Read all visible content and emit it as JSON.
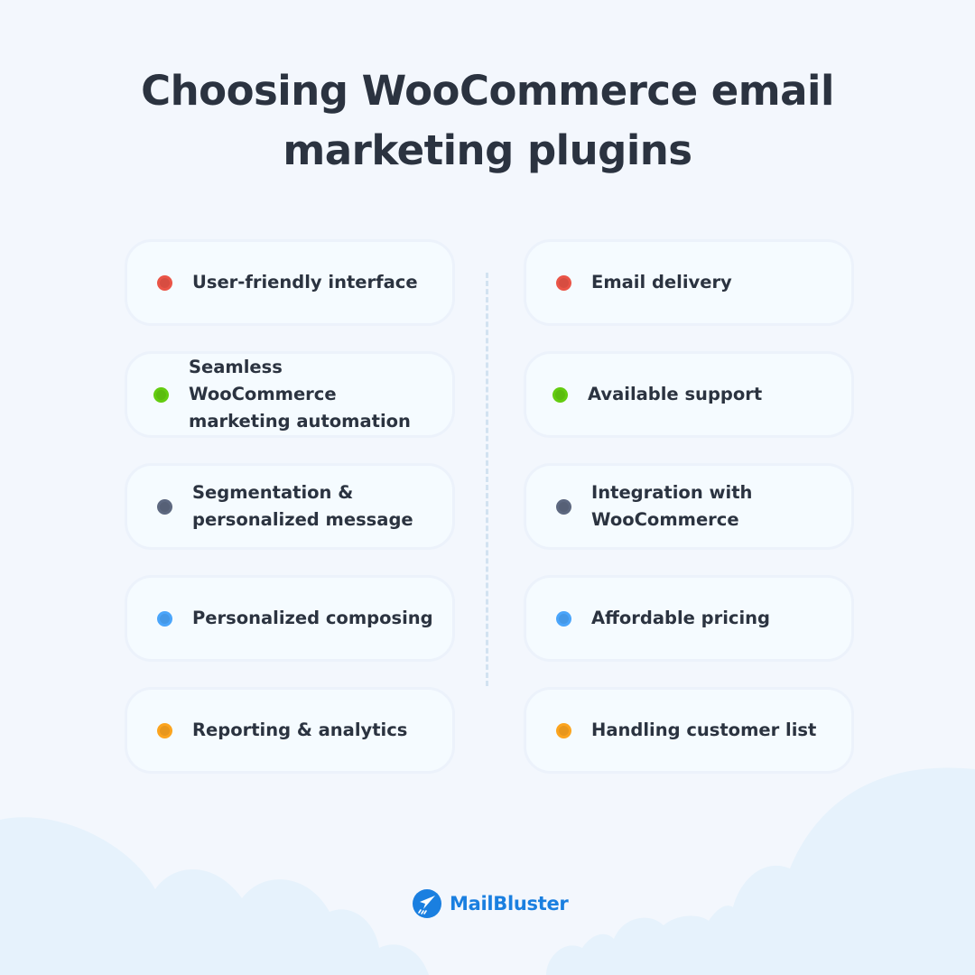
{
  "title": {
    "line1": "Choosing WooCommerce email",
    "line2": "marketing plugins"
  },
  "colors": {
    "red": "#ea5447",
    "green": "#63cc10",
    "slate": "#5d6880",
    "blue": "#4aa5fb",
    "orange": "#fca41e",
    "brand": "#1a7fe0"
  },
  "left_column": [
    {
      "label": "User-friendly interface",
      "color": "#ea5447"
    },
    {
      "label": "Seamless WooCommerce marketing automation",
      "color": "#63cc10"
    },
    {
      "label": "Segmentation & personalized message",
      "color": "#5d6880"
    },
    {
      "label": "Personalized composing",
      "color": "#4aa5fb"
    },
    {
      "label": "Reporting & analytics",
      "color": "#fca41e"
    }
  ],
  "right_column": [
    {
      "label": "Email delivery",
      "color": "#ea5447"
    },
    {
      "label": "Available support",
      "color": "#63cc10"
    },
    {
      "label": "Integration with WooCommerce",
      "color": "#5d6880"
    },
    {
      "label": "Affordable pricing",
      "color": "#4aa5fb"
    },
    {
      "label": "Handling customer list",
      "color": "#fca41e"
    }
  ],
  "footer": {
    "brand_name": "MailBluster",
    "logo_icon": "paper-plane-icon"
  }
}
